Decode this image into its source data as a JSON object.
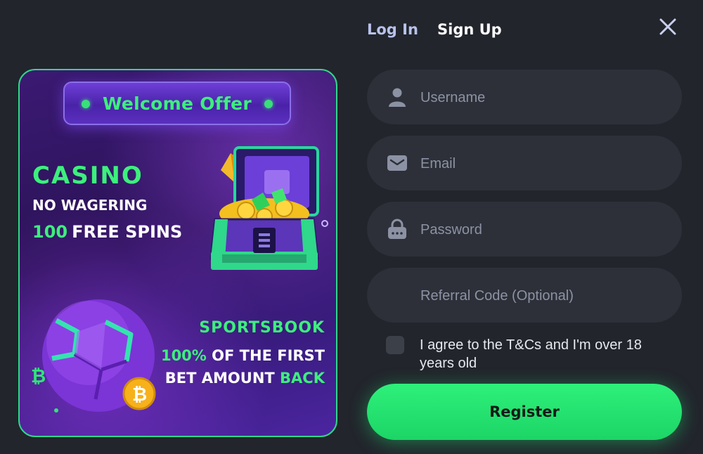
{
  "header": {
    "login_tab": "Log In",
    "signup_tab": "Sign Up",
    "close_icon": "close-icon"
  },
  "promo": {
    "badge": "Welcome Offer",
    "casino_title": "CASINO",
    "casino_line1": "NO WAGERING",
    "casino_spins_number": "100",
    "casino_spins_text": "FREE SPINS",
    "sports_title": "SPORTSBOOK",
    "sports_line1_highlight": "100%",
    "sports_line1_rest": "OF THE FIRST",
    "sports_line2_rest": "BET AMOUNT",
    "sports_line2_highlight": "BACK",
    "images": [
      "treasure-chest-icon",
      "soccer-ball-icon",
      "bitcoin-coin-icon"
    ]
  },
  "form": {
    "username_placeholder": "Username",
    "email_placeholder": "Email",
    "password_placeholder": "Password",
    "referral_placeholder": "Referral Code (Optional)",
    "terms_checked": false,
    "terms_label": "I agree to the T&Cs and I'm over 18 years old",
    "register_label": "Register"
  },
  "colors": {
    "background": "#22252c",
    "field_bg": "#2d3038",
    "accent_green": "#2ef07a",
    "promo_purple": "#3b1a73",
    "tab_login": "#b8c2ea"
  }
}
